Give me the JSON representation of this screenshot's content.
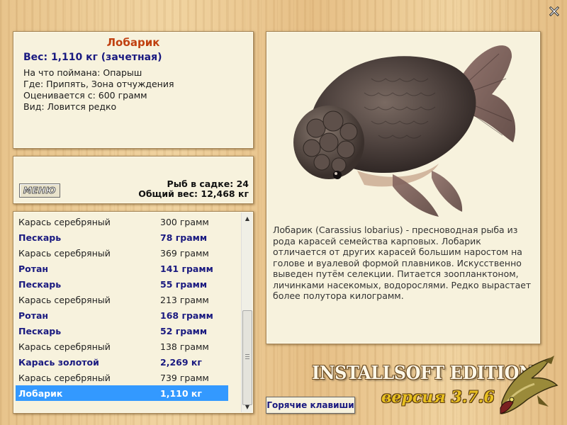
{
  "info": {
    "title": "Лобарик",
    "weight": "Вес: 1,110 кг (зачетная)",
    "lines": [
      "На что поймана: Опарыш",
      "Где: Припять, Зона отчуждения",
      "Оценивается с: 600 грамм",
      "Вид: Ловится редко"
    ]
  },
  "summary": {
    "menu_label": "МЕНЮ",
    "fish_count": "Рыб в садке: 24",
    "total_weight": "Общий вес: 12,468 кг"
  },
  "catch_list": [
    {
      "name": "Карась серебряный",
      "weight": "300 грамм",
      "style": "plain"
    },
    {
      "name": "Пескарь",
      "weight": "78 грамм",
      "style": "bold"
    },
    {
      "name": "Карась серебряный",
      "weight": "369 грамм",
      "style": "plain"
    },
    {
      "name": "Ротан",
      "weight": "141 грамм",
      "style": "bold"
    },
    {
      "name": "Пескарь",
      "weight": "55 грамм",
      "style": "bold"
    },
    {
      "name": "Карась серебряный",
      "weight": "213 грамм",
      "style": "plain"
    },
    {
      "name": "Ротан",
      "weight": "168 грамм",
      "style": "bold"
    },
    {
      "name": "Пескарь",
      "weight": "52 грамм",
      "style": "bold"
    },
    {
      "name": "Карась серебряный",
      "weight": "138 грамм",
      "style": "plain"
    },
    {
      "name": "Карась золотой",
      "weight": "2,269 кг",
      "style": "bold"
    },
    {
      "name": "Карась серебряный",
      "weight": "739 грамм",
      "style": "plain"
    },
    {
      "name": "Лобарик",
      "weight": "1,110 кг",
      "style": "selected"
    }
  ],
  "description": "Лобарик (Carassius lobarius) - пресноводная рыба из рода карасей семейства карповых. Лобарик отличается от других карасей большим наростом на голове и вуалевой формой плавников. Искусственно выведен путём селекции. Питается зоопланктоном, личинками насекомых, водорослями. Редко вырастает более полутора килограмм.",
  "hotkeys_label": "Горячие клавиши",
  "branding": {
    "edition": "INSTALLSOFT EDITION",
    "version": "версия 3.7.6"
  },
  "icons": {
    "close": "close-icon",
    "fish_picture": "fish-picture",
    "pike": "pike-icon"
  },
  "colors": {
    "title": "#c04010",
    "accent": "#1a1a80",
    "selection": "#3399ff"
  }
}
